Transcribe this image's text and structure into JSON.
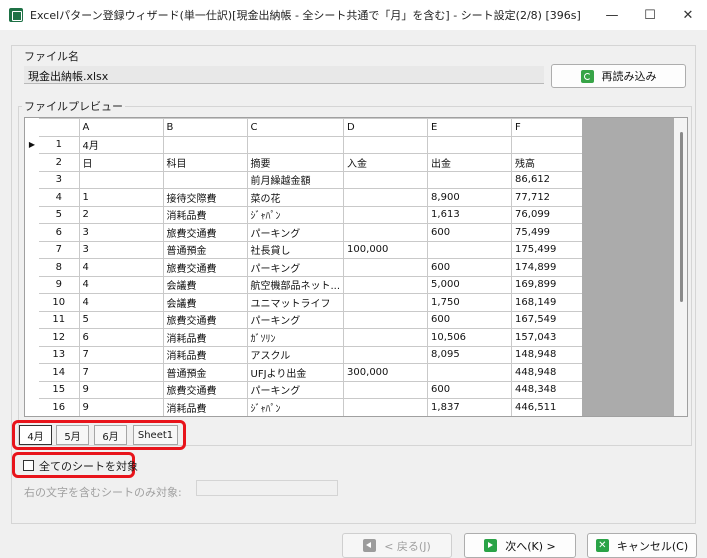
{
  "window": {
    "title": "Excelパターン登録ウィザード(単一仕訳)[現金出納帳 - 全シート共通で「月」を含む] - シート設定(2/8) [396s]",
    "minimize_glyph": "—",
    "maximize_glyph": "☐",
    "close_glyph": "✕"
  },
  "file": {
    "section_label": "ファイル名",
    "filename": "現金出納帳.xlsx",
    "reload_label": "再読み込み"
  },
  "preview": {
    "section_label": "ファイルプレビュー",
    "selected_row_marker": "▶",
    "columns": [
      "A",
      "B",
      "C",
      "D",
      "E",
      "F"
    ],
    "rows": [
      {
        "num": "1",
        "cells": [
          "4月",
          "",
          "",
          "",
          "",
          ""
        ]
      },
      {
        "num": "2",
        "cells": [
          "日",
          "科目",
          "摘要",
          "入金",
          "出金",
          "残高"
        ]
      },
      {
        "num": "3",
        "cells": [
          "",
          "",
          "前月繰越金額",
          "",
          "",
          "86,612"
        ]
      },
      {
        "num": "4",
        "cells": [
          "1",
          "接待交際費",
          "菜の花",
          "",
          "8,900",
          "77,712"
        ]
      },
      {
        "num": "5",
        "cells": [
          "2",
          "消耗品費",
          "ｼﾞｬﾊﾟﾝ",
          "",
          "1,613",
          "76,099"
        ]
      },
      {
        "num": "6",
        "cells": [
          "3",
          "旅費交通費",
          "パーキング",
          "",
          "600",
          "75,499"
        ]
      },
      {
        "num": "7",
        "cells": [
          "3",
          "普通預金",
          "社長貸し",
          "100,000",
          "",
          "175,499"
        ]
      },
      {
        "num": "8",
        "cells": [
          "4",
          "旅費交通費",
          "パーキング",
          "",
          "600",
          "174,899"
        ]
      },
      {
        "num": "9",
        "cells": [
          "4",
          "会議費",
          "航空機部品ネット...",
          "",
          "5,000",
          "169,899"
        ]
      },
      {
        "num": "10",
        "cells": [
          "4",
          "会議費",
          "ユニマットライフ",
          "",
          "1,750",
          "168,149"
        ]
      },
      {
        "num": "11",
        "cells": [
          "5",
          "旅費交通費",
          "パーキング",
          "",
          "600",
          "167,549"
        ]
      },
      {
        "num": "12",
        "cells": [
          "6",
          "消耗品費",
          "ｶﾞｿﾘﾝ",
          "",
          "10,506",
          "157,043"
        ]
      },
      {
        "num": "13",
        "cells": [
          "7",
          "消耗品費",
          "アスクル",
          "",
          "8,095",
          "148,948"
        ]
      },
      {
        "num": "14",
        "cells": [
          "7",
          "普通預金",
          "UFJより出金",
          "300,000",
          "",
          "448,948"
        ]
      },
      {
        "num": "15",
        "cells": [
          "9",
          "旅費交通費",
          "パーキング",
          "",
          "600",
          "448,348"
        ]
      },
      {
        "num": "16",
        "cells": [
          "9",
          "消耗品費",
          "ｼﾞｬﾊﾟﾝ",
          "",
          "1,837",
          "446,511"
        ]
      }
    ]
  },
  "sheet_tabs": [
    "4月",
    "5月",
    "6月",
    "Sheet1"
  ],
  "options": {
    "all_sheets_label": "全てのシートを対象",
    "filter_label": "右の文字を含むシートのみ対象:",
    "filter_value": ""
  },
  "footer": {
    "back_label": "< 戻る(J)",
    "next_label": "次へ(K) >",
    "cancel_label": "キャンセル(C)"
  },
  "colors": {
    "highlight_red": "#e8141b",
    "excel_green": "#2aa347"
  }
}
